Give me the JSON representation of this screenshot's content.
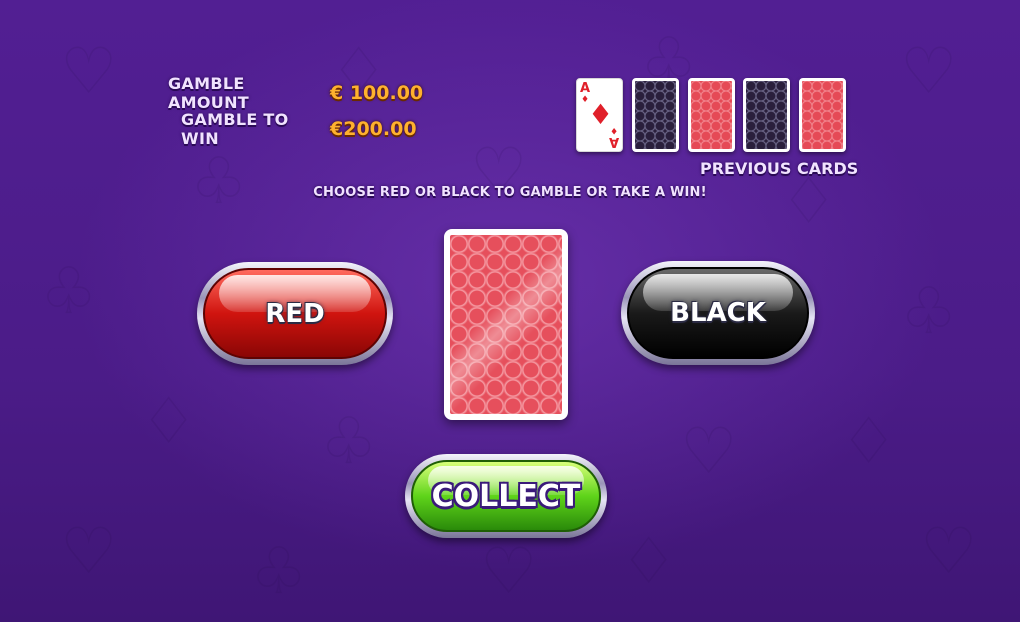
{
  "info": {
    "gamble_amount_label": "GAMBLE AMOUNT",
    "gamble_amount_value": "€ 100.00",
    "gamble_to_win_label": "GAMBLE TO WIN",
    "gamble_to_win_value": "€200.00"
  },
  "previous_cards": {
    "label": "PREVIOUS CARDS",
    "cards": [
      {
        "type": "face",
        "rank": "A",
        "suit": "diamond"
      },
      {
        "type": "back",
        "color": "black"
      },
      {
        "type": "back",
        "color": "red"
      },
      {
        "type": "back",
        "color": "black"
      },
      {
        "type": "back",
        "color": "red"
      }
    ]
  },
  "instruction": "CHOOSE RED OR BLACK TO GAMBLE OR TAKE A WIN!",
  "buttons": {
    "red": "RED",
    "black": "BLACK",
    "collect": "COLLECT"
  },
  "current_card": {
    "type": "back",
    "color": "red"
  },
  "colors": {
    "background": "#4e1d8c",
    "value_orange": "#ffb12e",
    "red_button": "#d0140f",
    "black_button": "#1a1a1a",
    "collect_button": "#5fd41a"
  }
}
